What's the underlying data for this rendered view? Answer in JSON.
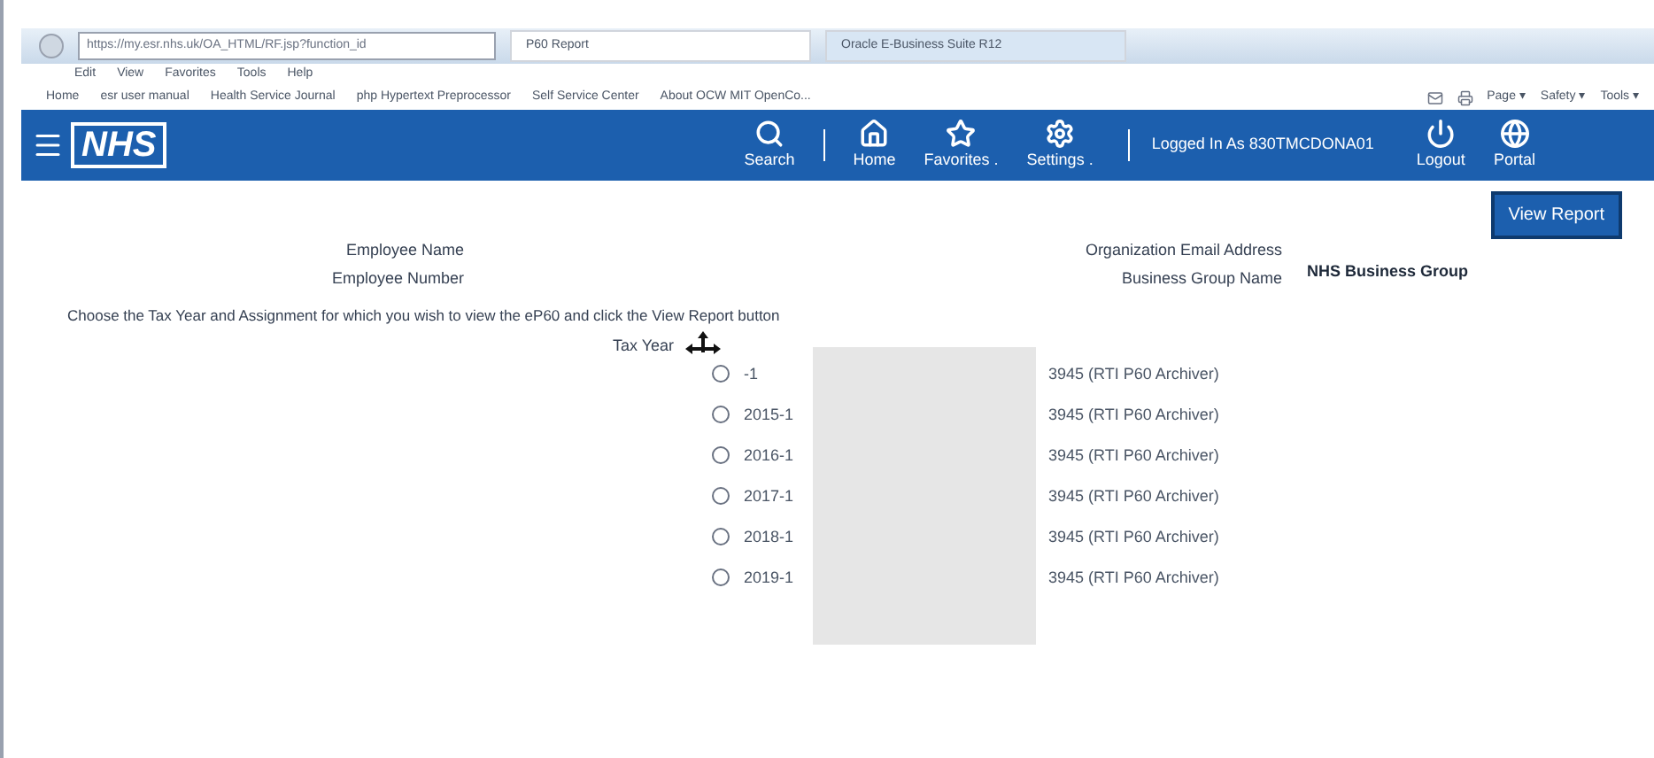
{
  "browser": {
    "address": "https://my.esr.nhs.uk/OA_HTML/RF.jsp?function_id",
    "tabs": [
      {
        "label": "P60 Report",
        "selected": true
      },
      {
        "label": "Oracle E-Business Suite R12",
        "selected": false
      }
    ],
    "menu": [
      "Edit",
      "View",
      "Favorites",
      "Tools",
      "Help"
    ],
    "favorites": [
      "Home",
      "esr user manual",
      "Health Service Journal",
      "php Hypertext Preprocessor",
      "Self Service Center",
      "About OCW MIT OpenCo..."
    ],
    "commands": [
      "Page ▾",
      "Safety ▾",
      "Tools ▾"
    ]
  },
  "header": {
    "logo": "NHS",
    "nav": [
      {
        "kind": "search",
        "label": "Search"
      },
      {
        "kind": "home",
        "label": "Home"
      },
      {
        "kind": "star",
        "label": "Favorites ."
      },
      {
        "kind": "gear",
        "label": "Settings ."
      }
    ],
    "user": "Logged In As 830TMCDONA01",
    "actions": [
      {
        "kind": "power",
        "label": "Logout"
      },
      {
        "kind": "globe",
        "label": "Portal"
      }
    ]
  },
  "view_button": "View Report",
  "fields_left": [
    "Employee Name",
    "Employee Number"
  ],
  "fields_right": [
    {
      "label": "Organization Email Address"
    },
    {
      "label": "Business Group Name",
      "value": "NHS Business Group"
    }
  ],
  "instruction": "Choose the Tax Year and Assignment for which you wish to view the eP60 and click the View Report button",
  "tax_year_label": "Tax Year",
  "options": [
    {
      "year": "-1",
      "assignment": "3945 (RTI P60 Archiver)",
      "selected": false
    },
    {
      "year": "2015-1",
      "assignment": "3945 (RTI P60 Archiver)",
      "selected": false
    },
    {
      "year": "2016-1",
      "assignment": "3945 (RTI P60 Archiver)",
      "selected": false
    },
    {
      "year": "2017-1",
      "assignment": "3945 (RTI P60 Archiver)",
      "selected": false
    },
    {
      "year": "2018-1",
      "assignment": "3945 (RTI P60 Archiver)",
      "selected": false
    },
    {
      "year": "2019-1",
      "assignment": "3945 (RTI P60 Archiver)",
      "selected": false
    }
  ]
}
